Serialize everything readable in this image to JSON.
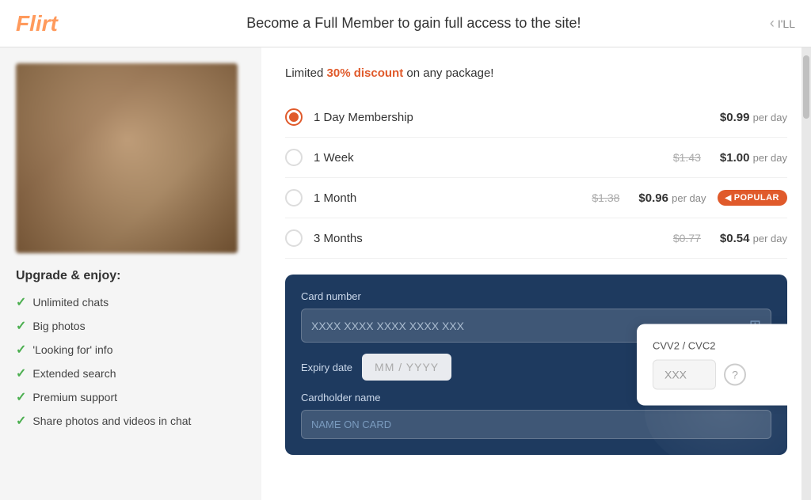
{
  "header": {
    "logo": "Flirt",
    "title": "Become a Full Member to gain full access to the site!",
    "nav_text": "I'LL"
  },
  "discount_banner": {
    "prefix": "Limited ",
    "discount_pct": "30% discount",
    "suffix": " on any package!"
  },
  "membership_options": [
    {
      "id": "1day",
      "label": "1 Day Membership",
      "selected": true,
      "price_original": null,
      "price_current": "$0.99",
      "price_unit": "per day"
    },
    {
      "id": "1week",
      "label": "1 Week",
      "selected": false,
      "price_original": "$1.43",
      "price_current": "$1.00",
      "price_unit": "per day"
    },
    {
      "id": "1month",
      "label": "1 Month",
      "selected": false,
      "price_original": "$1.38",
      "price_current": "$0.96",
      "price_unit": "per day",
      "badge": "POPULAR"
    },
    {
      "id": "3months",
      "label": "3 Months",
      "selected": false,
      "price_original": "$0.77",
      "price_current": "$0.54",
      "price_unit": "per day"
    }
  ],
  "upgrade_section": {
    "title": "Upgrade & enjoy:",
    "features": [
      "Unlimited chats",
      "Big photos",
      "'Looking for' info",
      "Extended search",
      "Premium support",
      "Share photos and videos in chat"
    ]
  },
  "payment_form": {
    "card_number_label": "Card number",
    "card_number_placeholder": "XXXX XXXX XXXX XXXX XXX",
    "expiry_label": "Expiry date",
    "expiry_placeholder": "MM  /  YYYY",
    "cardholder_label": "Cardholder name",
    "cardholder_placeholder": "NAME ON CARD",
    "cvv_label": "CVV2 / CVC2",
    "cvv_placeholder": "XXX"
  }
}
